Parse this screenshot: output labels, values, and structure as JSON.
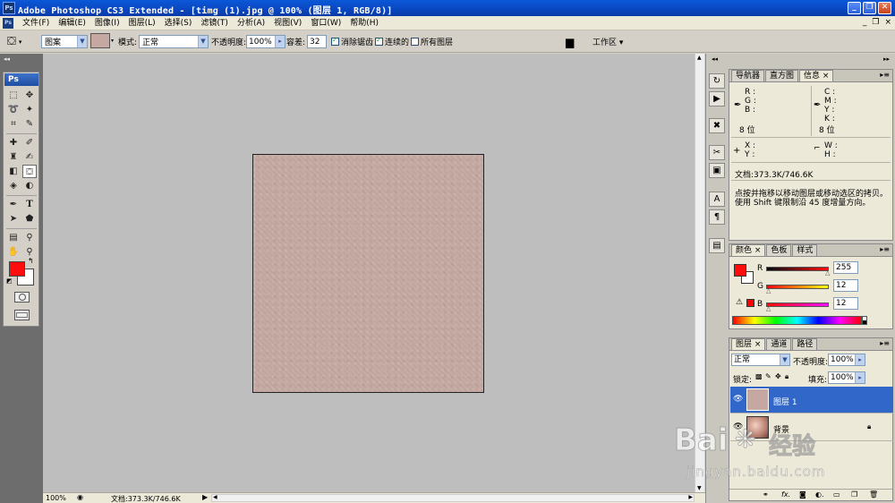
{
  "window": {
    "title": "Adobe Photoshop CS3 Extended - [timg (1).jpg @ 100% (图层 1, RGB/8)]",
    "app_icon_text": "Ps",
    "minimize": "_",
    "maximize": "❐",
    "close": "✕"
  },
  "menubar": {
    "items": [
      "文件(F)",
      "编辑(E)",
      "图像(I)",
      "图层(L)",
      "选择(S)",
      "滤镜(T)",
      "分析(A)",
      "视图(V)",
      "窗口(W)",
      "帮助(H)"
    ],
    "doc_min": "_",
    "doc_restore": "❐",
    "doc_close": "×"
  },
  "options": {
    "fill_mode": "图案",
    "mode_label": "模式:",
    "mode_value": "正常",
    "opacity_label": "不透明度:",
    "opacity_value": "100%",
    "tolerance_label": "容差:",
    "tolerance_value": "32",
    "antialias_label": "消除锯齿",
    "contiguous_label": "连续的",
    "all_layers_label": "所有图层",
    "workspace_label": "工作区 ▾",
    "pattern_color": "#c4a8a1"
  },
  "toolbox": {
    "logo": "Ps",
    "fg_color": "#ff0c0c",
    "bg_color": "#ffffff"
  },
  "info_panel": {
    "tabs": [
      "导航器",
      "直方图",
      "信息 ×"
    ],
    "rgb_labels": [
      "R :",
      "G :",
      "B :"
    ],
    "cmyk_labels": [
      "C :",
      "M :",
      "Y :",
      "K :"
    ],
    "bit_depth_left": "8 位",
    "bit_depth_right": "8 位",
    "xy_labels": [
      "X :",
      "Y :"
    ],
    "wh_labels": [
      "W :",
      "H :"
    ],
    "doc_size": "文档:373.3K/746.6K",
    "hint_line1": "点按并拖移以移动图层或移动选区的拷贝。",
    "hint_line2": "使用 Shift 键限制沿 45 度增量方向。"
  },
  "color_panel": {
    "tabs": [
      "颜色 ×",
      "色板",
      "样式"
    ],
    "r_label": "R",
    "g_label": "G",
    "b_label": "B",
    "r_value": "255",
    "g_value": "12",
    "b_value": "12",
    "fg_color": "#ff0c0c"
  },
  "layers_panel": {
    "tabs": [
      "图层 ×",
      "通道",
      "路径"
    ],
    "blend_mode": "正常",
    "opacity_label": "不透明度:",
    "opacity_value": "100%",
    "lock_label": "锁定:",
    "fill_label": "填充:",
    "fill_value": "100%",
    "layers": [
      {
        "name": "图层 1",
        "selected": true
      },
      {
        "name": "背景",
        "selected": false
      }
    ]
  },
  "statusbar": {
    "zoom": "100%",
    "doc_info": "文档:373.3K/746.6K"
  },
  "watermark": {
    "brand": "Bai",
    "brand_suffix": "经验",
    "url": "jingyan.baidu.com"
  }
}
